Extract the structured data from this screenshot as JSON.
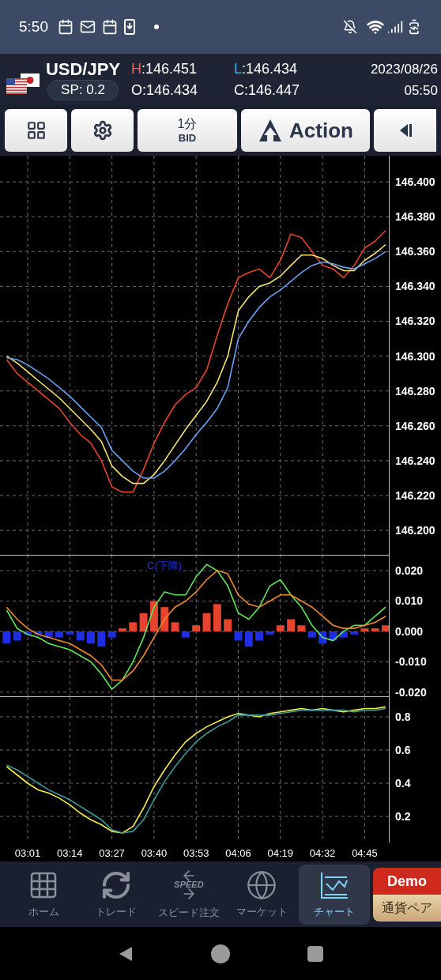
{
  "status_bar": {
    "time": "5:50"
  },
  "header": {
    "pair": "USD/JPY",
    "spread": "SP: 0.2",
    "high_label": "H",
    "high": ":146.451",
    "low_label": "L",
    "low": ":146.434",
    "open": "O:146.434",
    "close": "C:146.447",
    "date": "2023/08/26",
    "time": "05:50"
  },
  "toolbar": {
    "timeframe": "1分",
    "price_type": "BID",
    "action": "Action"
  },
  "price_chart": {
    "chart_data": {
      "type": "line",
      "grid": true,
      "categories": [
        null,
        null,
        null,
        null,
        null,
        null,
        null,
        null,
        null,
        null,
        null,
        null,
        null,
        null,
        null,
        null,
        null,
        null,
        null,
        null,
        null,
        null,
        null,
        null,
        null,
        null,
        null,
        null,
        null,
        null,
        null,
        null,
        null,
        null,
        null,
        null,
        null
      ],
      "ylim": [
        146.186,
        146.415
      ],
      "yticks": [
        {
          "value": 146.2,
          "label": "146.200"
        },
        {
          "value": 146.22,
          "label": "146.220"
        },
        {
          "value": 146.24,
          "label": "146.240"
        },
        {
          "value": 146.26,
          "label": "146.260"
        },
        {
          "value": 146.28,
          "label": "146.280"
        },
        {
          "value": 146.3,
          "label": "146.300"
        },
        {
          "value": 146.32,
          "label": "146.320"
        },
        {
          "value": 146.34,
          "label": "146.340"
        },
        {
          "value": 146.36,
          "label": "146.360"
        },
        {
          "value": 146.38,
          "label": "146.380"
        },
        {
          "value": 146.4,
          "label": "146.400"
        }
      ],
      "series": [
        {
          "color": "#e8432e",
          "values": [
            146.298,
            146.29,
            146.285,
            146.28,
            146.275,
            146.27,
            146.262,
            146.255,
            146.25,
            146.24,
            146.225,
            146.222,
            146.222,
            146.235,
            146.25,
            146.262,
            146.272,
            146.278,
            146.282,
            146.292,
            146.312,
            146.33,
            146.345,
            146.348,
            146.35,
            146.345,
            146.355,
            146.37,
            146.368,
            146.36,
            146.352,
            146.35,
            146.345,
            146.352,
            146.362,
            146.366,
            146.372
          ]
        },
        {
          "color": "#f5e66a",
          "values": [
            146.3,
            146.296,
            146.291,
            146.286,
            146.281,
            146.276,
            146.27,
            146.264,
            146.258,
            146.251,
            146.237,
            146.231,
            146.227,
            146.227,
            146.232,
            146.24,
            146.249,
            146.258,
            146.266,
            146.274,
            146.285,
            146.3,
            146.326,
            146.334,
            146.34,
            146.342,
            146.346,
            146.352,
            146.358,
            146.358,
            146.356,
            146.352,
            146.349,
            146.349,
            146.355,
            146.359,
            146.364
          ]
        },
        {
          "color": "#6aa0f0",
          "values": [
            146.299,
            146.298,
            146.295,
            146.291,
            146.287,
            146.282,
            146.277,
            146.271,
            146.265,
            146.259,
            146.246,
            146.24,
            146.234,
            146.23,
            146.23,
            146.234,
            146.24,
            146.247,
            146.255,
            146.262,
            146.27,
            146.282,
            146.31,
            146.32,
            146.328,
            146.334,
            146.338,
            146.343,
            146.348,
            146.352,
            146.354,
            146.353,
            146.351,
            146.35,
            146.353,
            146.356,
            146.36
          ]
        }
      ]
    }
  },
  "macd_panel": {
    "label": "C(下降)",
    "histogram": {
      "chart_data": {
        "type": "bar",
        "grid": true,
        "categories": [
          null,
          null,
          null,
          null,
          null,
          null,
          null,
          null,
          null,
          null,
          null,
          null,
          null,
          null,
          null,
          null,
          null,
          null,
          null,
          null,
          null,
          null,
          null,
          null,
          null,
          null,
          null,
          null,
          null,
          null,
          null,
          null,
          null,
          null,
          null,
          null,
          null
        ],
        "ylim": [
          -0.0216,
          0.0252
        ],
        "yticks": [
          {
            "value": 0.02,
            "label": "0.020"
          },
          {
            "value": 0.01,
            "label": "0.010"
          },
          {
            "value": 0,
            "label": "0.000"
          },
          {
            "value": -0.01,
            "label": "-0.010"
          },
          {
            "value": -0.02,
            "label": "-0.020"
          }
        ],
        "series": [
          {
            "color": "#e8432e",
            "values": [
              null,
              null,
              null,
              null,
              null,
              null,
              null,
              null,
              null,
              null,
              null,
              0.001,
              0.003,
              0.006,
              0.01,
              0.008,
              0.003,
              null,
              0.002,
              0.006,
              0.009,
              0.004,
              null,
              null,
              null,
              null,
              0.002,
              0.004,
              0.002,
              null,
              null,
              null,
              null,
              null,
              0.001,
              0.001,
              0.002
            ]
          },
          {
            "color": "#1f2ee6",
            "values": [
              -0.004,
              -0.003,
              -0.001,
              -0.001,
              -0.002,
              -0.002,
              -0.001,
              -0.003,
              -0.004,
              -0.005,
              -0.002,
              null,
              null,
              null,
              null,
              null,
              null,
              -0.002,
              null,
              null,
              null,
              null,
              -0.003,
              -0.005,
              -0.003,
              -0.001,
              null,
              null,
              null,
              -0.002,
              -0.004,
              -0.003,
              -0.002,
              -0.001,
              null,
              null,
              null
            ]
          }
        ]
      }
    },
    "lines": {
      "chart_data": {
        "type": "line",
        "categories": [
          null,
          null,
          null,
          null,
          null,
          null,
          null,
          null,
          null,
          null,
          null,
          null,
          null,
          null,
          null,
          null,
          null,
          null,
          null,
          null,
          null,
          null,
          null,
          null,
          null,
          null,
          null,
          null,
          null,
          null,
          null,
          null,
          null,
          null,
          null,
          null,
          null
        ],
        "ylim": [
          -0.0216,
          0.0252
        ],
        "series": [
          {
            "color": "#5ee65a",
            "values": [
              0.007,
              0.001,
              -0.001,
              -0.002,
              -0.004,
              -0.005,
              -0.006,
              -0.008,
              -0.01,
              -0.014,
              -0.019,
              -0.016,
              -0.01,
              -0.002,
              0.008,
              0.013,
              0.012,
              0.012,
              0.018,
              0.022,
              0.02,
              0.015,
              0.006,
              0.004,
              0.008,
              0.015,
              0.017,
              0.012,
              0.008,
              0.002,
              -0.002,
              -0.003,
              0.0,
              0.002,
              0.002,
              0.005,
              0.008
            ]
          },
          {
            "color": "#f08a2e",
            "values": [
              0.008,
              0.004,
              0.001,
              -0.001,
              -0.002,
              -0.003,
              -0.004,
              -0.006,
              -0.008,
              -0.011,
              -0.016,
              -0.016,
              -0.013,
              -0.008,
              -0.002,
              0.004,
              0.008,
              0.01,
              0.013,
              0.017,
              0.02,
              0.019,
              0.012,
              0.009,
              0.008,
              0.01,
              0.012,
              0.012,
              0.01,
              0.008,
              0.005,
              0.002,
              0.001,
              0.001,
              0.002,
              0.003,
              0.005
            ]
          }
        ]
      }
    }
  },
  "stochastic_panel": {
    "chart_data": {
      "type": "line",
      "grid": true,
      "categories": [
        null,
        null,
        "03:01",
        null,
        null,
        null,
        "03:14",
        null,
        null,
        null,
        "03:27",
        null,
        null,
        null,
        "03:40",
        null,
        null,
        null,
        "03:53",
        null,
        null,
        null,
        "04:06",
        null,
        null,
        null,
        "04:19",
        null,
        null,
        null,
        "04:32",
        null,
        null,
        null,
        "04:45",
        null,
        null
      ],
      "ylim": [
        0.043,
        0.919
      ],
      "yticks": [
        0.2,
        0.4,
        0.6,
        0.8
      ],
      "series": [
        {
          "color": "#f2ec4a",
          "values": [
            0.5,
            0.45,
            0.4,
            0.36,
            0.34,
            0.31,
            0.27,
            0.22,
            0.18,
            0.15,
            0.11,
            0.1,
            0.14,
            0.25,
            0.38,
            0.48,
            0.57,
            0.65,
            0.7,
            0.74,
            0.77,
            0.8,
            0.82,
            0.81,
            0.8,
            0.82,
            0.83,
            0.84,
            0.85,
            0.84,
            0.85,
            0.84,
            0.83,
            0.84,
            0.85,
            0.85,
            0.86
          ]
        },
        {
          "color": "#3a9a9a",
          "values": [
            0.51,
            0.48,
            0.44,
            0.4,
            0.36,
            0.33,
            0.3,
            0.26,
            0.22,
            0.18,
            0.12,
            0.1,
            0.11,
            0.18,
            0.3,
            0.41,
            0.5,
            0.58,
            0.65,
            0.7,
            0.74,
            0.77,
            0.81,
            0.81,
            0.81,
            0.81,
            0.82,
            0.83,
            0.84,
            0.84,
            0.84,
            0.84,
            0.84,
            0.83,
            0.84,
            0.84,
            0.85
          ]
        }
      ]
    }
  },
  "bottom_nav": {
    "items": [
      {
        "label": "ホーム",
        "kind": "home",
        "selected": false
      },
      {
        "label": "トレード",
        "kind": "trade",
        "selected": false
      },
      {
        "label": "スピード注文",
        "kind": "speed",
        "icon_text": "SPEED",
        "selected": false
      },
      {
        "label": "マーケット",
        "kind": "market",
        "selected": false
      },
      {
        "label": "チャート",
        "kind": "chart",
        "selected": true
      }
    ],
    "demo_badge": "Demo",
    "pair_button": "通貨ペア"
  }
}
